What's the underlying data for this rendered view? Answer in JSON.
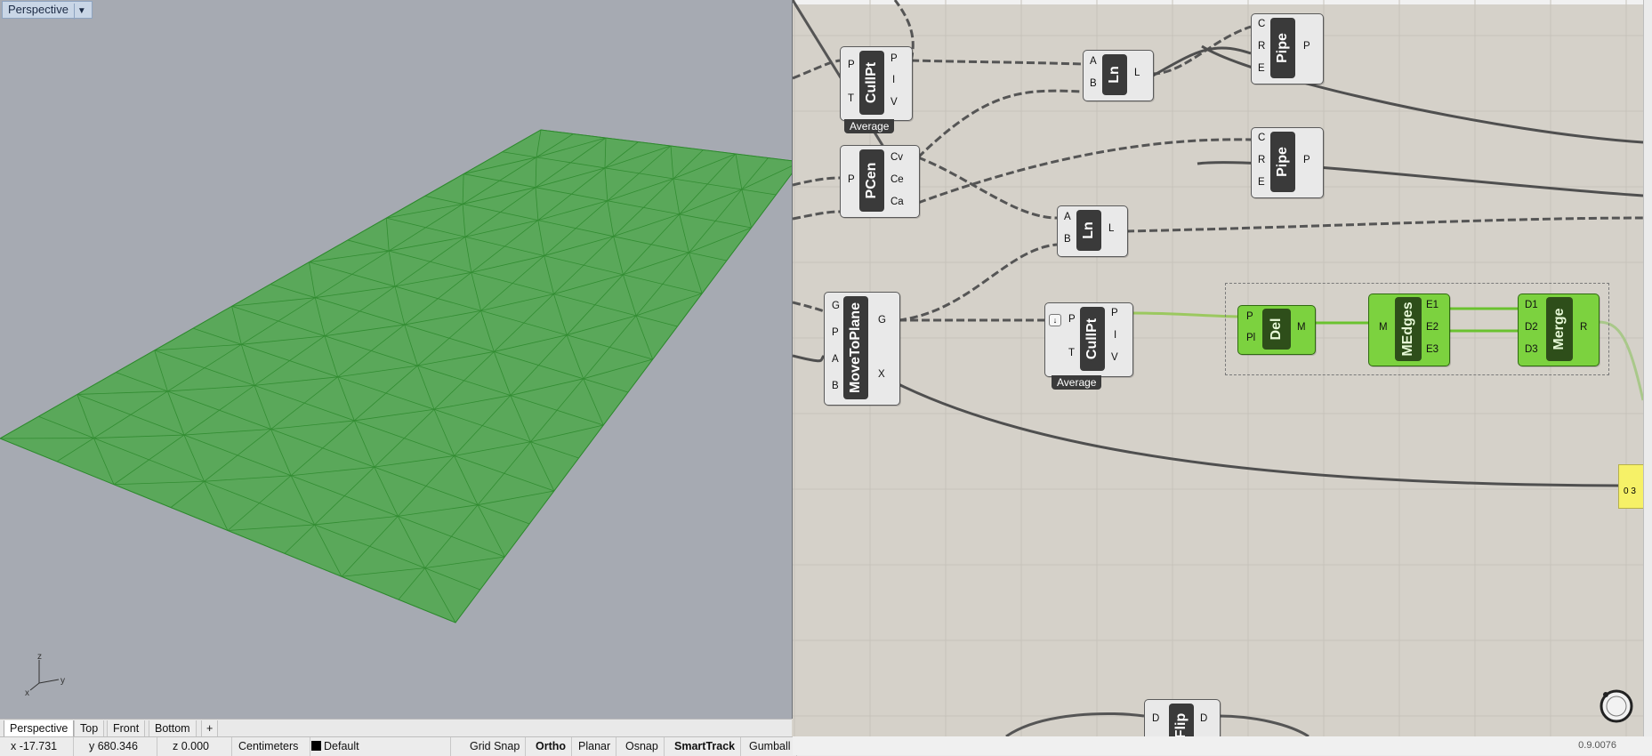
{
  "viewport": {
    "title": "Perspective",
    "axis_labels": {
      "z": "z",
      "y": "y",
      "x": "x"
    },
    "mesh_color": "#5aa85a",
    "mesh_edge_color": "#2e8a2e"
  },
  "viewport_tabs": [
    "Perspective",
    "Top",
    "Front",
    "Bottom"
  ],
  "status_bar": {
    "x": "x -17.731",
    "y": "y 680.346",
    "z": "z 0.000",
    "units": "Centimeters",
    "layer": "Default",
    "toggles": [
      "Grid Snap",
      "Ortho",
      "Planar",
      "Osnap",
      "SmartTrack",
      "Gumball"
    ],
    "active_toggles": [
      "Ortho",
      "SmartTrack"
    ]
  },
  "grasshopper": {
    "version": "0.9.0076",
    "components": {
      "cullpt1": {
        "name": "CullPt",
        "inputs": [
          "P",
          "T"
        ],
        "outputs": [
          "P",
          "I",
          "V"
        ],
        "tag": "Average"
      },
      "pcen": {
        "name": "PCen",
        "inputs": [
          "P"
        ],
        "outputs": [
          "Cv",
          "Ce",
          "Ca"
        ]
      },
      "ln1": {
        "name": "Ln",
        "inputs": [
          "A",
          "B"
        ],
        "outputs": [
          "L"
        ]
      },
      "ln2": {
        "name": "Ln",
        "inputs": [
          "A",
          "B"
        ],
        "outputs": [
          "L"
        ]
      },
      "pipe1": {
        "name": "Pipe",
        "inputs": [
          "C",
          "R",
          "E"
        ],
        "outputs": [
          "P"
        ]
      },
      "pipe2": {
        "name": "Pipe",
        "inputs": [
          "C",
          "R",
          "E"
        ],
        "outputs": [
          "P"
        ]
      },
      "movetoplane": {
        "name": "MoveToPlane",
        "inputs": [
          "G",
          "P",
          "A",
          "B"
        ],
        "outputs": [
          "G",
          "X"
        ]
      },
      "cullpt2": {
        "name": "CullPt",
        "inputs": [
          "P",
          "T"
        ],
        "outputs": [
          "P",
          "I",
          "V"
        ],
        "tag": "Average"
      },
      "del": {
        "name": "Del",
        "inputs": [
          "P",
          "Pl"
        ],
        "outputs": [
          "M"
        ]
      },
      "medges": {
        "name": "MEdges",
        "inputs": [
          "M"
        ],
        "outputs": [
          "E1",
          "E2",
          "E3"
        ]
      },
      "merge": {
        "name": "Merge",
        "inputs": [
          "D1",
          "D2",
          "D3"
        ],
        "outputs": [
          "R"
        ]
      },
      "flip": {
        "name": "Flip",
        "inputs": [
          "D"
        ],
        "outputs": [
          "D"
        ]
      }
    },
    "panel_value": "0 3"
  }
}
